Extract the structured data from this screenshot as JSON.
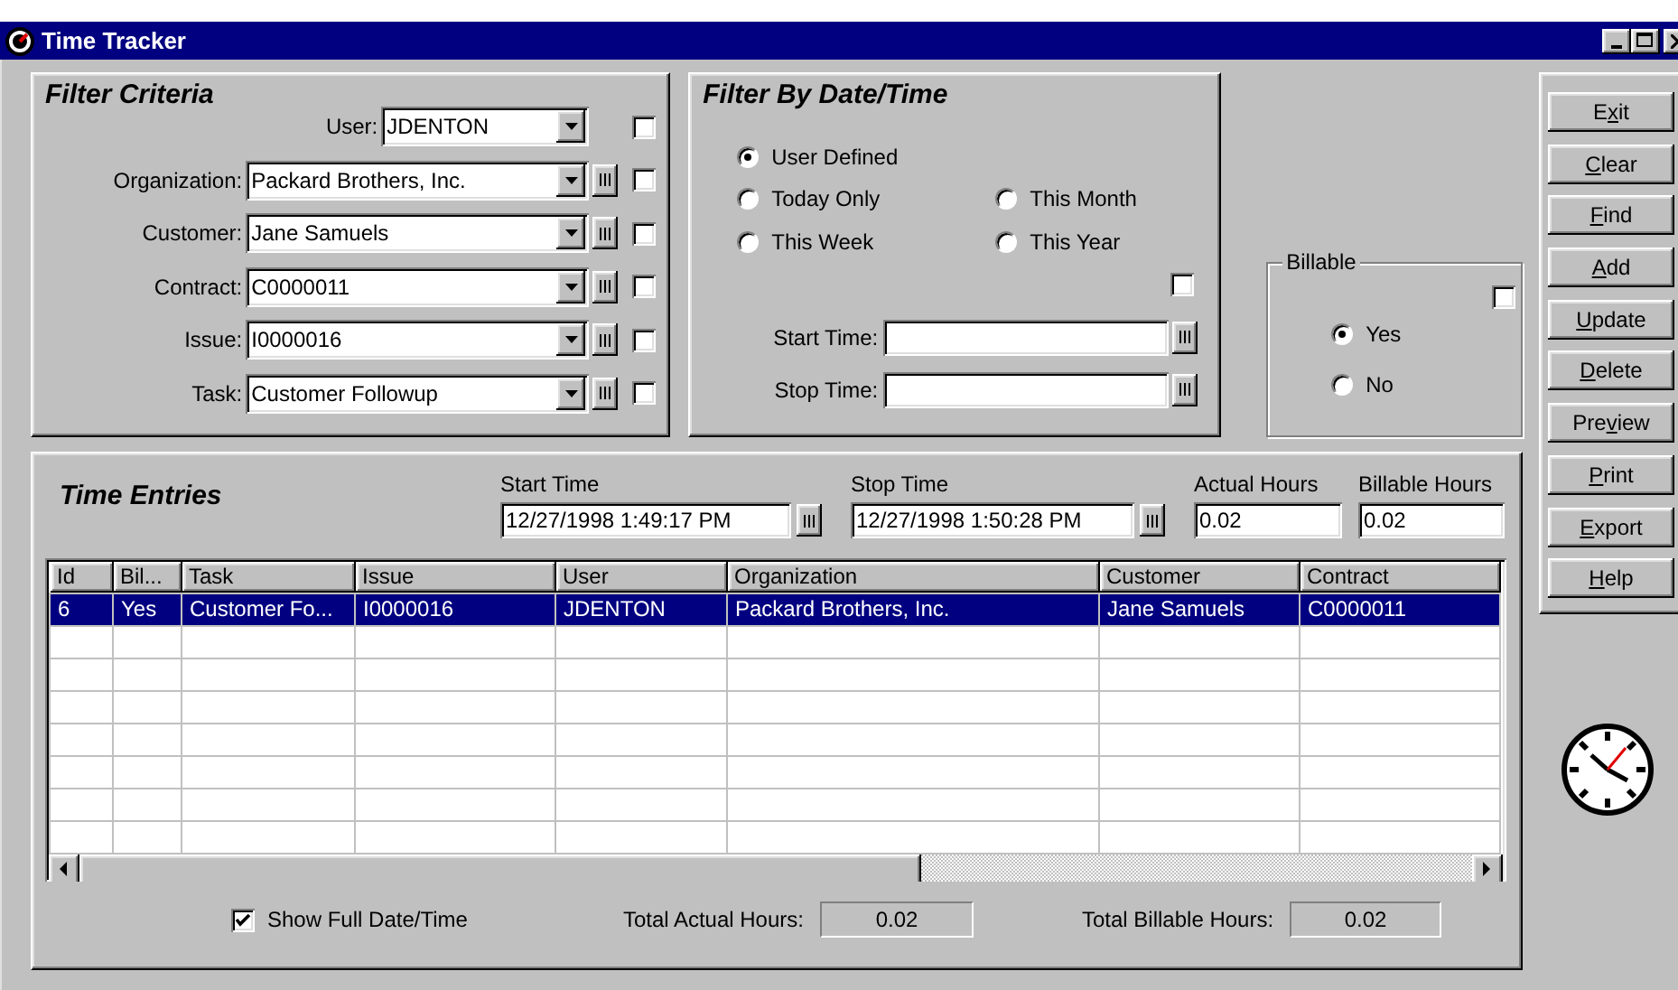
{
  "window": {
    "title": "Time Tracker"
  },
  "filter_criteria": {
    "title": "Filter Criteria",
    "fields": [
      {
        "label": "User:",
        "value": "JDENTON",
        "lookup": false,
        "checked": false
      },
      {
        "label": "Organization:",
        "value": "Packard Brothers, Inc.",
        "lookup": true,
        "checked": false
      },
      {
        "label": "Customer:",
        "value": "Jane Samuels",
        "lookup": true,
        "checked": false
      },
      {
        "label": "Contract:",
        "value": "C0000011",
        "lookup": true,
        "checked": false
      },
      {
        "label": "Issue:",
        "value": "I0000016",
        "lookup": true,
        "checked": false
      },
      {
        "label": "Task:",
        "value": "Customer Followup",
        "lookup": true,
        "checked": false
      }
    ]
  },
  "date_filter": {
    "title": "Filter By Date/Time",
    "options": [
      {
        "label": "User Defined",
        "selected": true
      },
      {
        "label": "Today Only",
        "selected": false
      },
      {
        "label": "This Month",
        "selected": false
      },
      {
        "label": "This Week",
        "selected": false
      },
      {
        "label": "This Year",
        "selected": false
      }
    ],
    "checked": false,
    "fields": [
      {
        "label": "Start Time:"
      },
      {
        "label": "Stop Time:"
      }
    ]
  },
  "billable": {
    "title": "Billable",
    "checked": false,
    "options": [
      {
        "label": "Yes",
        "selected": true
      },
      {
        "label": "No",
        "selected": false
      }
    ]
  },
  "time_entries": {
    "title": "Time Entries",
    "inputs": [
      {
        "label": "Start Time",
        "value": "12/27/1998 1:49:17 PM",
        "lookup": true
      },
      {
        "label": "Stop Time",
        "value": "12/27/1998 1:50:28 PM",
        "lookup": true
      },
      {
        "label": "Actual Hours",
        "value": "0.02",
        "lookup": false
      },
      {
        "label": "Billable Hours",
        "value": "0.02",
        "lookup": false
      }
    ],
    "table": {
      "columns": [
        "Id",
        "Bil...",
        "Task",
        "Issue",
        "User",
        "Organization",
        "Customer",
        "Contract"
      ],
      "rows": [
        {
          "cells": [
            "6",
            "Yes",
            "Customer Fo...",
            "I0000016",
            "JDENTON",
            "Packard Brothers, Inc.",
            "Jane Samuels",
            "C0000011"
          ],
          "selected": true
        }
      ]
    },
    "show_full_datetime": {
      "label": "Show Full Date/Time",
      "checked": true
    },
    "totals": [
      {
        "label": "Total Actual Hours:",
        "value": "0.02"
      },
      {
        "label": "Total Billable Hours:",
        "value": "0.02"
      }
    ]
  },
  "buttons": [
    {
      "pre": "E",
      "key": "x",
      "post": "it"
    },
    {
      "key": "C",
      "post": "lear"
    },
    {
      "key": "F",
      "post": "ind"
    },
    {
      "key": "A",
      "post": "dd"
    },
    {
      "key": "U",
      "post": "pdate"
    },
    {
      "key": "D",
      "post": "elete"
    },
    {
      "pre": "Pre",
      "key": "v",
      "post": "iew"
    },
    {
      "key": "P",
      "post": "rint"
    },
    {
      "key": "E",
      "post": "xport"
    },
    {
      "key": "H",
      "post": "elp"
    }
  ]
}
